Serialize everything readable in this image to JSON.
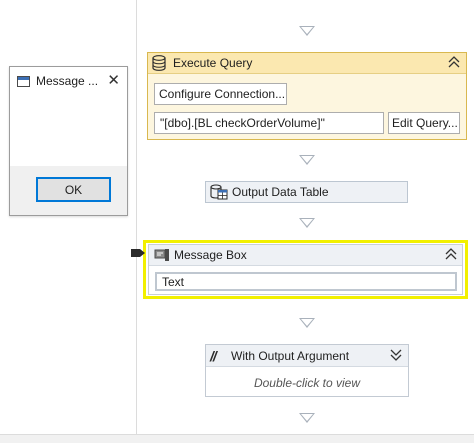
{
  "dialog": {
    "title": "Message ...",
    "close_glyph": "✕",
    "ok_label": "OK",
    "icon": "app-window-icon"
  },
  "execute_query": {
    "title": "Execute Query",
    "icon": "database-icon",
    "collapse_glyph": "⌃",
    "configure_label": "Configure Connection...",
    "query_value": "\"[dbo].[BL checkOrderVolume]\"",
    "edit_query_label": "Edit Query..."
  },
  "output_data_table": {
    "title": "Output Data Table",
    "icon": "data-table-icon"
  },
  "message_box": {
    "title": "Message Box",
    "icon": "message-box-icon",
    "collapse_glyph": "⌃",
    "text_value": "Text",
    "highlight_color": "#f2f000",
    "breakpoint_icon": "breakpoint-marker-icon"
  },
  "with_output_argument": {
    "title": "With Output Argument",
    "icon": "code-slash-icon",
    "icon_glyph": "//",
    "expand_glyph": "⌄",
    "hint": "Double-click to view"
  },
  "colors": {
    "execute_query_header": "#fbe8b0",
    "activity_header": "#eef1f5",
    "arrow": "#a9b1bb",
    "selection": "#0078d7"
  }
}
